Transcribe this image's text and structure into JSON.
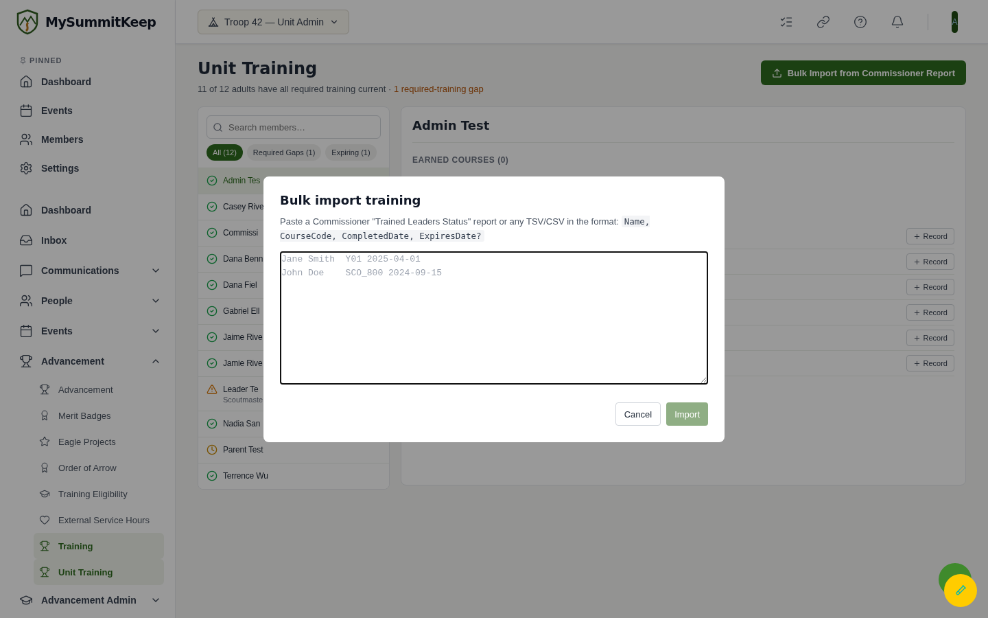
{
  "brand": {
    "name": "MySummitKeep"
  },
  "unit_selector": {
    "label": "Troop 42 — Unit Admin"
  },
  "avatar": {
    "initial": "A"
  },
  "sidebar": {
    "pinned_label": "PINNED",
    "pinned": [
      {
        "label": "Dashboard"
      },
      {
        "label": "Events"
      },
      {
        "label": "Members"
      },
      {
        "label": "Settings"
      }
    ],
    "items": [
      {
        "label": "Dashboard"
      },
      {
        "label": "Inbox"
      },
      {
        "label": "Communications",
        "expanded": false
      },
      {
        "label": "People",
        "expanded": false
      },
      {
        "label": "Events",
        "expanded": false
      },
      {
        "label": "Advancement",
        "expanded": true,
        "children": [
          {
            "label": "Advancement",
            "selected": false
          },
          {
            "label": "Merit Badges",
            "selected": false
          },
          {
            "label": "Eagle Projects",
            "selected": false
          },
          {
            "label": "Order of Arrow",
            "selected": false
          },
          {
            "label": "Training Eligibility",
            "selected": false
          },
          {
            "label": "External Service Hours",
            "selected": false
          },
          {
            "label": "Training",
            "selected": true
          },
          {
            "label": "Unit Training",
            "selected": true
          }
        ]
      },
      {
        "label": "Advancement Admin",
        "expanded": false
      }
    ]
  },
  "page": {
    "title": "Unit Training",
    "summary": "11 of 12 adults have all required training current · ",
    "gap_note": "1 required-training gap",
    "bulk_button": "Bulk Import from Commissioner Report"
  },
  "members": {
    "search_placeholder": "Search members…",
    "filters": [
      {
        "label": "All (12)",
        "selected": true
      },
      {
        "label": "Required Gaps (1)",
        "selected": false
      },
      {
        "label": "Expiring (1)",
        "selected": false
      }
    ],
    "rows": [
      {
        "name": "Admin Tes",
        "kind": "ok",
        "selected": true
      },
      {
        "name": "Casey Rive",
        "kind": "ok",
        "selected": false
      },
      {
        "name": "Commissi",
        "kind": "ok",
        "selected": false
      },
      {
        "name": "Dana Benn",
        "kind": "ok",
        "selected": false
      },
      {
        "name": "Dana Fiel",
        "kind": "ok",
        "selected": false
      },
      {
        "name": "Gabriel Ell",
        "kind": "ok",
        "selected": false
      },
      {
        "name": "Jaime Rive",
        "kind": "ok",
        "selected": false
      },
      {
        "name": "Jamie Rive",
        "kind": "ok",
        "selected": false
      },
      {
        "name": "Leader Te",
        "subtitle": "Scoutmaste",
        "kind": "warning",
        "selected": false
      },
      {
        "name": "Nadia San",
        "kind": "ok",
        "selected": false
      },
      {
        "name": "Parent Test",
        "kind": "expiring",
        "selected": false
      },
      {
        "name": "Terrence Wu",
        "kind": "ok",
        "selected": false
      }
    ]
  },
  "detail": {
    "name": "Admin Test",
    "earned_heading": "EARNED COURSES (0)",
    "record_buttons": [
      "Record",
      "Record",
      "Record",
      "Record",
      "Record",
      "Record"
    ]
  },
  "dialog": {
    "title": "Bulk import training",
    "description": "Paste a Commissioner \"Trained Leaders Status\" report or any TSV/CSV in the format:",
    "format": "Name, CourseCode, CompletedDate, ExpiresDate?",
    "placeholder": "Jane Smith  Y01 2025-04-01\nJohn Doe    SCO_800 2024-09-15",
    "cancel": "Cancel",
    "import": "Import",
    "import_disabled": true
  }
}
